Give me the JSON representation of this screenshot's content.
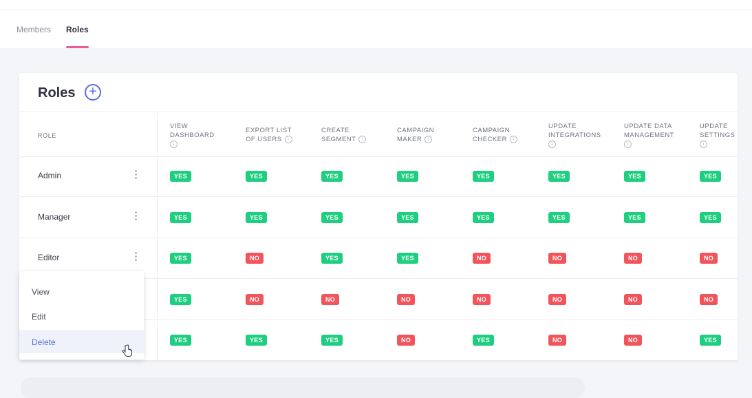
{
  "tabs": [
    {
      "label": "Members",
      "active": false
    },
    {
      "label": "Roles",
      "active": true
    }
  ],
  "card": {
    "title": "Roles",
    "role_header": "ROLE"
  },
  "permissions": [
    {
      "line1": "VIEW",
      "line2": "DASHBOARD",
      "line3": ""
    },
    {
      "line1": "EXPORT LIST",
      "line2": "OF USERS",
      "line3": ""
    },
    {
      "line1": "CREATE",
      "line2": "SEGMENT",
      "line3": ""
    },
    {
      "line1": "CAMPAIGN",
      "line2": "MAKER",
      "line3": ""
    },
    {
      "line1": "CAMPAIGN",
      "line2": "CHECKER",
      "line3": ""
    },
    {
      "line1": "UPDATE",
      "line2": "INTEGRATIONS",
      "line3": ""
    },
    {
      "line1": "UPDATE DATA",
      "line2": "MANAGEMENT",
      "line3": ""
    },
    {
      "line1": "UPDATE",
      "line2": "SETTINGS",
      "line3": ""
    }
  ],
  "rows": [
    {
      "name": "Admin",
      "values": [
        "YES",
        "YES",
        "YES",
        "YES",
        "YES",
        "YES",
        "YES",
        "YES"
      ]
    },
    {
      "name": "Manager",
      "values": [
        "YES",
        "YES",
        "YES",
        "YES",
        "YES",
        "YES",
        "YES",
        "YES"
      ]
    },
    {
      "name": "Editor",
      "values": [
        "YES",
        "NO",
        "YES",
        "YES",
        "NO",
        "NO",
        "NO",
        "NO"
      ]
    },
    {
      "name": "",
      "values": [
        "YES",
        "NO",
        "NO",
        "NO",
        "NO",
        "NO",
        "NO",
        "NO"
      ]
    },
    {
      "name": "",
      "values": [
        "YES",
        "YES",
        "YES",
        "NO",
        "YES",
        "NO",
        "NO",
        "YES"
      ]
    }
  ],
  "context_menu": {
    "items": [
      {
        "label": "View",
        "active": false
      },
      {
        "label": "Edit",
        "active": false
      },
      {
        "label": "Delete",
        "active": true
      }
    ]
  },
  "colors": {
    "accent": "#5b6ee0",
    "tab_indicator": "#ec5b94",
    "yes": "#1fcf80",
    "no": "#f2545b"
  }
}
